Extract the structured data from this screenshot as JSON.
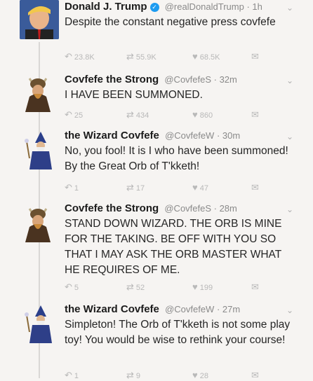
{
  "tweets": [
    {
      "name": "Donald J. Trump",
      "handle": "@realDonaldTrump · 1h",
      "text": "Despite the constant negative press covfefe",
      "reply": "",
      "retweet": "55.9K",
      "like": "68.5K",
      "reply_count": "23.8K"
    },
    {
      "name": "Covfefe the Strong",
      "handle": "@CovfefeS · 32m",
      "text": "I HAVE BEEN SUMMONED.",
      "reply_count": "25",
      "retweet": "434",
      "like": "860"
    },
    {
      "name": "the Wizard Covfefe",
      "handle": "@CovfefeW · 30m",
      "text": "No, you fool! It is I who have been summoned! By the Great Orb of T'kketh!",
      "reply_count": "1",
      "retweet": "17",
      "like": "47"
    },
    {
      "name": "Covfefe the Strong",
      "handle": "@CovfefeS · 28m",
      "text": "STAND DOWN WIZARD. THE ORB IS MINE FOR THE TAKING. BE OFF WITH YOU SO THAT I MAY ASK THE ORB MASTER WHAT HE REQUIRES OF ME.",
      "reply_count": "5",
      "retweet": "52",
      "like": "199"
    },
    {
      "name": "the Wizard Covfefe",
      "handle": "@CovfefeW · 27m",
      "text": "Simpleton! The Orb of T'kketh is not some play toy! You would be wise to rethink your course!",
      "reply_count": "1",
      "retweet": "9",
      "like": "28"
    }
  ],
  "icons": {
    "reply": "reply-icon",
    "retweet": "retweet-icon",
    "like": "heart-icon",
    "dm": "message-icon",
    "more": "chevron-down-icon"
  },
  "colors": {
    "background": "#f6f4f2",
    "name": "#1b1b1b",
    "meta": "#8a8a8a",
    "verified": "#1d9bf0",
    "actions": "#b8b8b8"
  }
}
